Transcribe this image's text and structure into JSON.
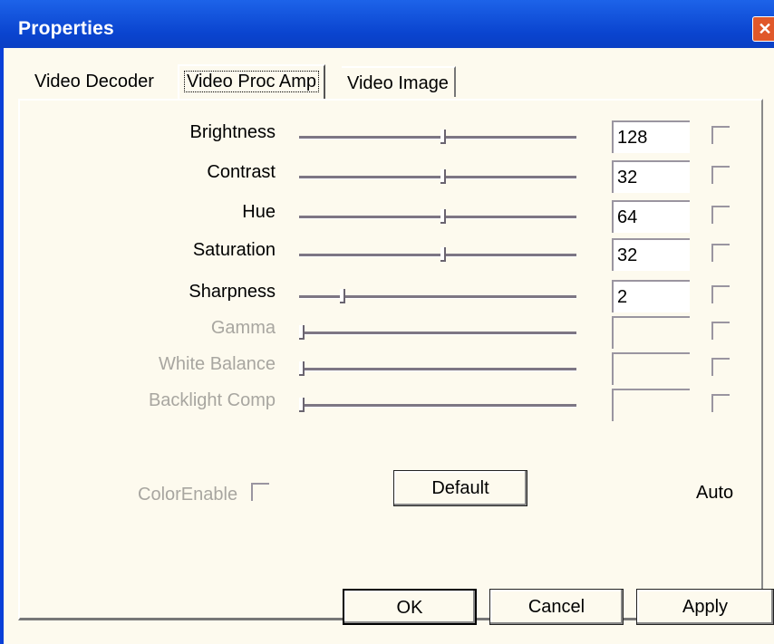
{
  "window": {
    "title": "Properties",
    "close_glyph": "✕"
  },
  "tabs": [
    {
      "label": "Video Decoder"
    },
    {
      "label": "Video Proc Amp"
    },
    {
      "label": "Video Image"
    }
  ],
  "rows": [
    {
      "label": "Brightness",
      "value": "128",
      "slider_fraction": 0.52,
      "enabled": true
    },
    {
      "label": "Contrast",
      "value": "32",
      "slider_fraction": 0.52,
      "enabled": true
    },
    {
      "label": "Hue",
      "value": "64",
      "slider_fraction": 0.52,
      "enabled": true
    },
    {
      "label": "Saturation",
      "value": "32",
      "slider_fraction": 0.52,
      "enabled": true
    },
    {
      "label": "Sharpness",
      "value": "2",
      "slider_fraction": 0.15,
      "enabled": true
    },
    {
      "label": "Gamma",
      "value": "",
      "slider_fraction": 0.0,
      "enabled": false
    },
    {
      "label": "White Balance",
      "value": "",
      "slider_fraction": 0.0,
      "enabled": false
    },
    {
      "label": "Backlight Comp",
      "value": "",
      "slider_fraction": 0.0,
      "enabled": false
    }
  ],
  "color_enable_label": "ColorEnable",
  "default_button": "Default",
  "auto_label": "Auto",
  "buttons": {
    "ok": "OK",
    "cancel": "Cancel",
    "apply": "Apply"
  },
  "colors": {
    "titlebar": "#0a40d8",
    "panel": "#fdfaee",
    "disabled_text": "#a8a6a0"
  }
}
